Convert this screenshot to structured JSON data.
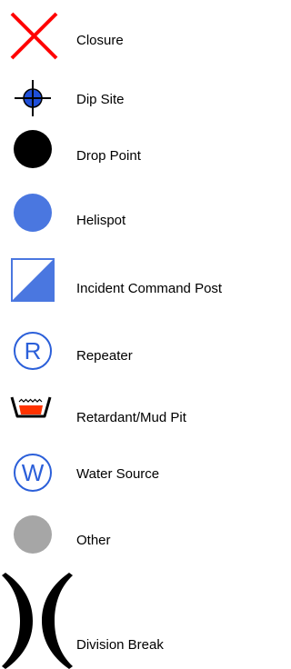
{
  "legend": {
    "items": [
      {
        "label": "Closure",
        "icon": "closure-x-icon",
        "color": "#ff0000"
      },
      {
        "label": "Dip Site",
        "icon": "dip-site-crosshair-icon",
        "color": "#1f4fd8"
      },
      {
        "label": "Drop Point",
        "icon": "drop-point-circle-icon",
        "color": "#000000"
      },
      {
        "label": "Helispot",
        "icon": "helispot-circle-icon",
        "color": "#4a77e0"
      },
      {
        "label": "Incident Command Post",
        "icon": "incident-command-post-icon",
        "color": "#4a77e0"
      },
      {
        "label": "Repeater",
        "icon": "repeater-r-circle-icon",
        "color": "#2b5fd9"
      },
      {
        "label": "Retardant/Mud Pit",
        "icon": "retardant-mud-pit-icon",
        "color": "#ff3300"
      },
      {
        "label": "Water Source",
        "icon": "water-source-w-circle-icon",
        "color": "#2b5fd9"
      },
      {
        "label": "Other",
        "icon": "other-circle-icon",
        "color": "#a6a6a6"
      },
      {
        "label": "Division Break",
        "icon": "division-break-icon",
        "color": "#000000"
      }
    ],
    "glyphs": {
      "repeater": "R",
      "water_source": "W"
    }
  }
}
